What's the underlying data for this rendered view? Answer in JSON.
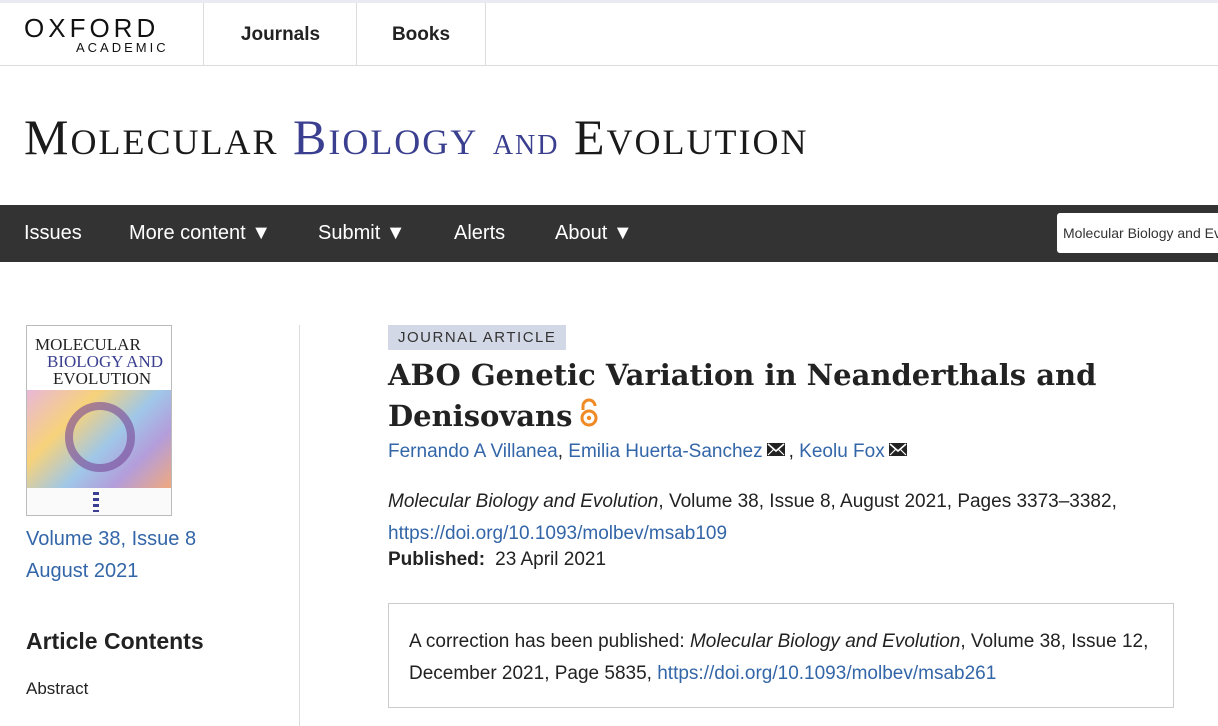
{
  "topbar": {
    "logo_main": "OXFORD",
    "logo_sub": "ACADEMIC",
    "tabs": [
      "Journals",
      "Books"
    ]
  },
  "masthead": {
    "w1_cap": "M",
    "w1_rest": "OLECULAR",
    "w2_cap": "B",
    "w2_rest": "IOLOGY",
    "w3": "AND",
    "w4_cap": "E",
    "w4_rest": "VOLUTION"
  },
  "nav": {
    "items": [
      "Issues",
      "More content ▼",
      "Submit ▼",
      "Alerts",
      "About ▼"
    ],
    "search_text": "Molecular Biology and Evolution"
  },
  "sidebar": {
    "cover_title_1": "MOLECULAR",
    "cover_title_2": "BIOLOGY AND",
    "cover_title_3": "EVOLUTION",
    "issue_link": "Volume 38, Issue 8",
    "date_link": "August 2021",
    "contents_heading": "Article Contents",
    "contents_items": [
      "Abstract"
    ]
  },
  "article": {
    "type_badge": "JOURNAL ARTICLE",
    "title_line1": "ABO Genetic Variation in Neanderthals and",
    "title_line2": "Denisovans",
    "authors": [
      "Fernando A Villanea",
      "Emilia Huerta-Sanchez",
      "Keolu Fox"
    ],
    "journal": "Molecular Biology and Evolution",
    "citation_rest": ", Volume 38, Issue 8, August 2021, Pages 3373–3382,",
    "doi": "https://doi.org/10.1093/molbev/msab109",
    "published_label": "Published:",
    "published_date": "23 April 2021",
    "correction_prefix": "A correction has been published: ",
    "correction_journal": "Molecular Biology and Evolution",
    "correction_rest": ", Volume 38, Issue 12, December 2021, Page 5835, ",
    "correction_doi": "https://doi.org/10.1093/molbev/msab261"
  },
  "colors": {
    "link": "#3366a8",
    "nav_bg": "#333333",
    "badge_bg": "#d3d8e6",
    "open_access": "#f08a24",
    "masthead_accent": "#3a3f8f"
  }
}
